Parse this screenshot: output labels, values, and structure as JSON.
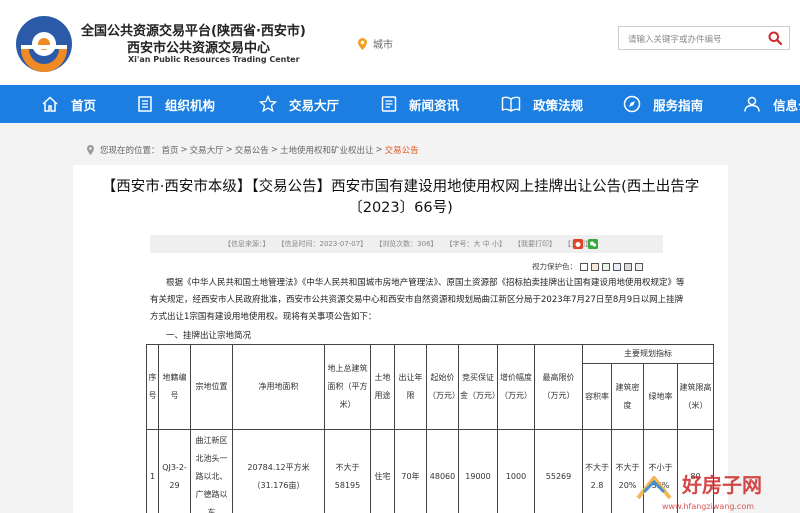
{
  "header": {
    "title": "全国公共资源交易平台(陕西省·西安市)",
    "subtitle": "西安市公共资源交易中心",
    "english": "Xi'an Public Resources Trading Center",
    "city_label": "城市",
    "search_placeholder": "请输入关键字或办件编号"
  },
  "nav": [
    {
      "label": "首页",
      "icon": "home-icon"
    },
    {
      "label": "组织机构",
      "icon": "org-icon"
    },
    {
      "label": "交易大厅",
      "icon": "star-icon"
    },
    {
      "label": "新闻资讯",
      "icon": "news-icon"
    },
    {
      "label": "政策法规",
      "icon": "book-icon"
    },
    {
      "label": "服务指南",
      "icon": "compass-icon"
    },
    {
      "label": "信息公开",
      "icon": "user-icon"
    }
  ],
  "breadcrumb": {
    "prefix": "您现在的位置：",
    "items": [
      "首页",
      "交易大厅",
      "交易公告",
      "土地使用权和矿业权出让"
    ],
    "current": "交易公告",
    "separator": ">"
  },
  "article": {
    "title_line1": "【西安市·西安市本级】【交易公告】西安市国有建设用地使用权网上挂牌出让公告(西土出告字",
    "title_line2": "〔2023〕66号)",
    "info": {
      "source": "【信息来源：】",
      "date": "【信息时间：2023-07-07】",
      "views": "【浏览次数：306】",
      "font_size": "【字号：大 中 小】",
      "print": "【我要打印】",
      "close": "【关闭】"
    },
    "vision_label": "视力保护色：",
    "vision_colors": [
      "#ffffff",
      "#f5ebd8",
      "#eaf4e6",
      "#e6eef8",
      "#dcdcdc",
      "#f0f0f0"
    ],
    "paragraph": "根据《中华人民共和国土地管理法》《中华人民共和国城市房地产管理法》、原国土资源部《招标拍卖挂牌出让国有建设用地使用权规定》等有关规定，经西安市人民政府批准，西安市公共资源交易中心和西安市自然资源和规划局曲江新区分局于2023年7月27日至8月9日以网上挂牌方式出让1宗国有建设用地使用权。现将有关事项公告如下：",
    "section_title": "一、挂牌出让宗地简况"
  },
  "table": {
    "headers": {
      "seq": "序号",
      "code": "地籍编号",
      "location": "宗地位置",
      "net_area": "净用地面积",
      "gross_area": "地上总建筑面积（平方米）",
      "use": "土地用途",
      "term": "出让年限",
      "start_price": "起始价（万元）",
      "deposit": "竞买保证金（万元）",
      "increment": "增价幅度（万元）",
      "max_price": "最高限价（万元）",
      "planning": "主要规划指标",
      "far": "容积率",
      "density": "建筑密度",
      "green": "绿地率",
      "height": "建筑限高（米）"
    },
    "row": {
      "seq": "1",
      "code": "QJ3-2-29",
      "location": "曲江新区北池头一路以北、广德路以东",
      "net_area": "20784.12平方米（31.176亩）",
      "gross_area": "不大于58195",
      "use": "住宅",
      "term": "70年",
      "start_price": "48060",
      "deposit": "19000",
      "increment": "1000",
      "max_price": "55269",
      "far": "不大于2.8",
      "density": "不大于20%",
      "green": "不小于35%",
      "height": "80"
    }
  },
  "watermark": {
    "brand": "好房子网",
    "url": "www.hfangziwang.com"
  },
  "colors": {
    "nav_bg": "#1b7ee0",
    "accent_orange": "#e05a22",
    "logo_blue": "#2b5aa8"
  }
}
